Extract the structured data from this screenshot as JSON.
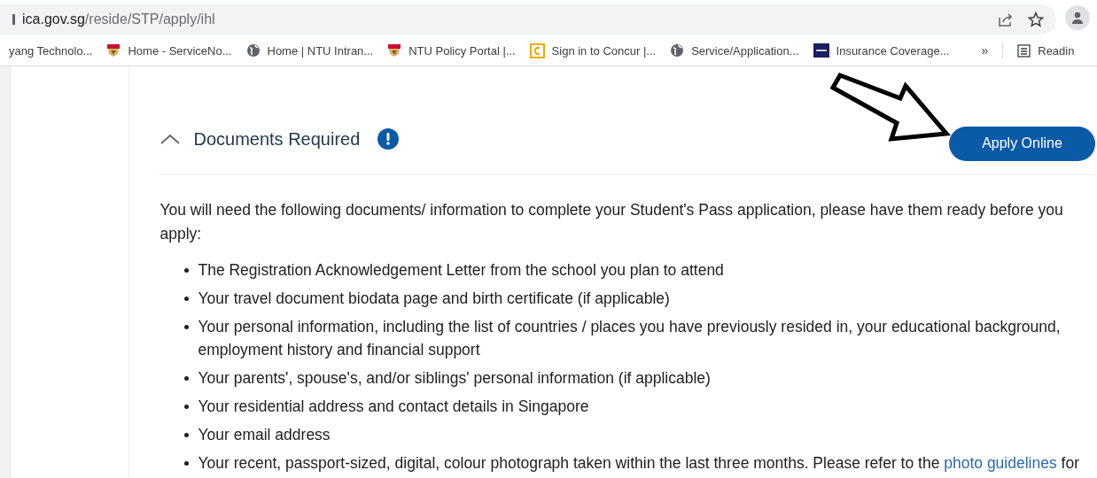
{
  "address_bar": {
    "domain": "ica.gov.sg",
    "path": "/reside/STP/apply/ihl"
  },
  "bookmarks": [
    {
      "label": "yang Technolo...",
      "kind": "none"
    },
    {
      "label": "Home - ServiceNo...",
      "kind": "crest"
    },
    {
      "label": "Home | NTU Intran...",
      "kind": "globe"
    },
    {
      "label": "NTU Policy Portal |...",
      "kind": "crest"
    },
    {
      "label": "Sign in to Concur |...",
      "kind": "concur"
    },
    {
      "label": "Service/Application...",
      "kind": "globe"
    },
    {
      "label": "Insurance Coverage...",
      "kind": "ntu"
    }
  ],
  "bookmarks_more": "»",
  "reading_list": "Readin",
  "section": {
    "title": "Documents Required",
    "expanded": true,
    "button": "Apply Online"
  },
  "intro": "You will need the following documents/ information to complete your Student's Pass application, please have them ready before you apply:",
  "items": [
    "The Registration Acknowledgement Letter from the school you plan to attend",
    "Your travel document biodata page and birth certificate (if applicable)",
    "Your personal information, including the list of countries / places you have previously resided in, your educational background, employment history and financial support",
    "Your parents', spouse's, and/or siblings' personal information (if applicable)",
    "Your residential address and contact details in Singapore",
    "Your email address"
  ],
  "last_item": {
    "before": "Your recent, passport-sized, digital, colour photograph taken within the last three months. Please refer to the ",
    "link": "photo guidelines",
    "after": " for"
  }
}
